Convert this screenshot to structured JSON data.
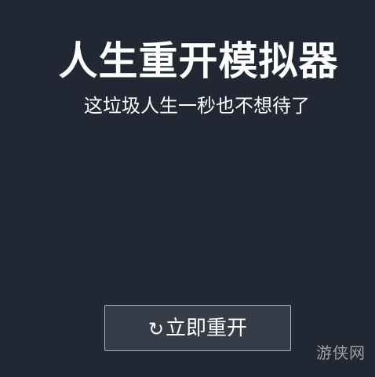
{
  "header": {
    "title": "人生重开模拟器",
    "subtitle": "这垃圾人生一秒也不想待了"
  },
  "actions": {
    "restart_icon": "↻",
    "restart_label": "立即重开"
  },
  "watermark": {
    "text": "游侠网"
  },
  "colors": {
    "background": "#222833",
    "button_background": "#363c48",
    "button_border": "#aab0bb",
    "text": "#ffffff"
  }
}
